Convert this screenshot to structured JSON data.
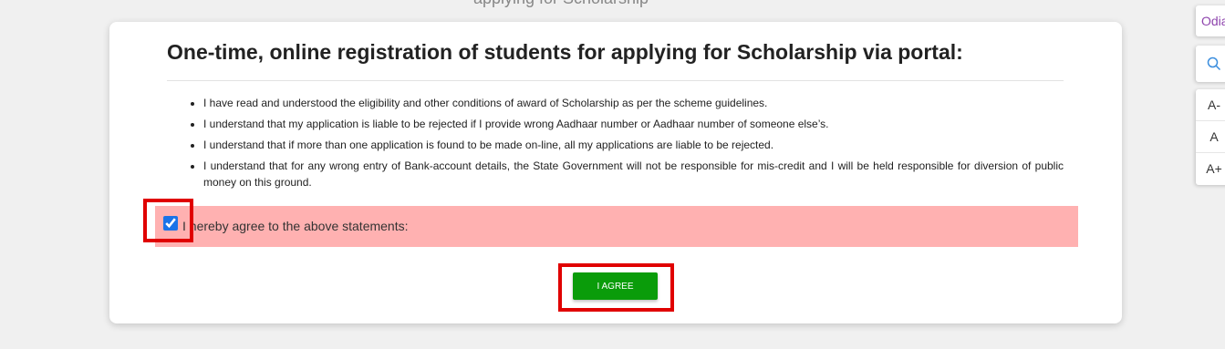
{
  "page": {
    "background_header_text": "applying for Scholarship"
  },
  "card": {
    "title": "One-time, online registration of students for applying for Scholarship via portal:",
    "terms": [
      "I have read and understood the eligibility and other conditions of award of Scholarship as per the scheme guidelines.",
      "I understand that my application is liable to be rejected if I provide wrong Aadhaar number or Aadhaar number of someone else’s.",
      "I understand that if more than one application is found to be made on-line, all my applications are liable to be rejected.",
      "I understand that for any wrong entry of Bank-account details, the State Government will not be responsible for mis-credit and I will be held responsible for diversion of public money on this ground."
    ],
    "agree_label": "I hereby agree to the above statements:",
    "agree_checked": true,
    "agree_button_label": "I AGREE"
  },
  "side_tools": {
    "language_label": "Odia",
    "search_icon": "search-icon",
    "font_decrease_label": "A-",
    "font_normal_label": "A",
    "font_increase_label": "A+"
  },
  "colors": {
    "agree_bar": "#ffb1b1",
    "agree_button": "#0a9c0a",
    "highlight_box": "#e00000",
    "language_text": "#8e44ad"
  }
}
